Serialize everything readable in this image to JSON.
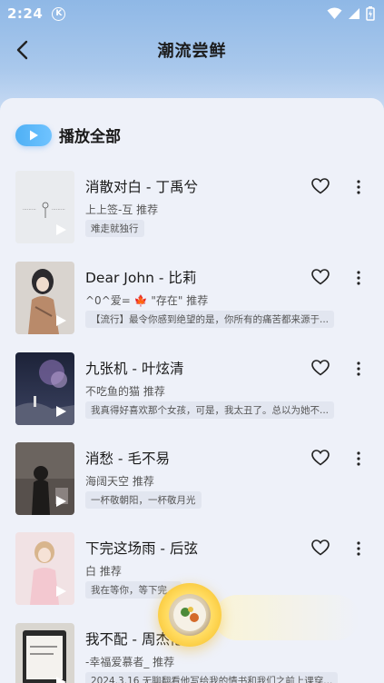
{
  "status_bar": {
    "time": "2:24",
    "badge": "K"
  },
  "header": {
    "title": "潮流尝鲜"
  },
  "play_all": {
    "label": "播放全部"
  },
  "songs": [
    {
      "title": "消散对白 - 丁禹兮",
      "recommender": "上上签-互 推荐",
      "tag": "难走就独行"
    },
    {
      "title": "Dear John - 比莉",
      "recommender": "^0^爱= 🍁 \"存在\" 推荐",
      "tag": "【流行】最令你感到绝望的是，你所有的痛苦都来源于..."
    },
    {
      "title": "九张机 - 叶炫清",
      "recommender": "不吃鱼的猫 推荐",
      "tag": "我真得好喜欢那个女孩，可是，我太丑了。总以为她不..."
    },
    {
      "title": "消愁 - 毛不易",
      "recommender": "海阔天空 推荐",
      "tag": "一杯敬朝阳，一杯敬月光"
    },
    {
      "title": "下完这场雨 - 后弦",
      "recommender": "白 推荐",
      "tag": "我在等你，等下完..."
    },
    {
      "title": "我不配 - 周杰伦",
      "recommender": "-幸福爱慕者_ 推荐",
      "tag": "2024.3.16 无聊翻看他写给我的情书和我们之前上课穿..."
    }
  ],
  "colors": {
    "accent": "#4fb0f5",
    "panel": "#eef1f9"
  }
}
